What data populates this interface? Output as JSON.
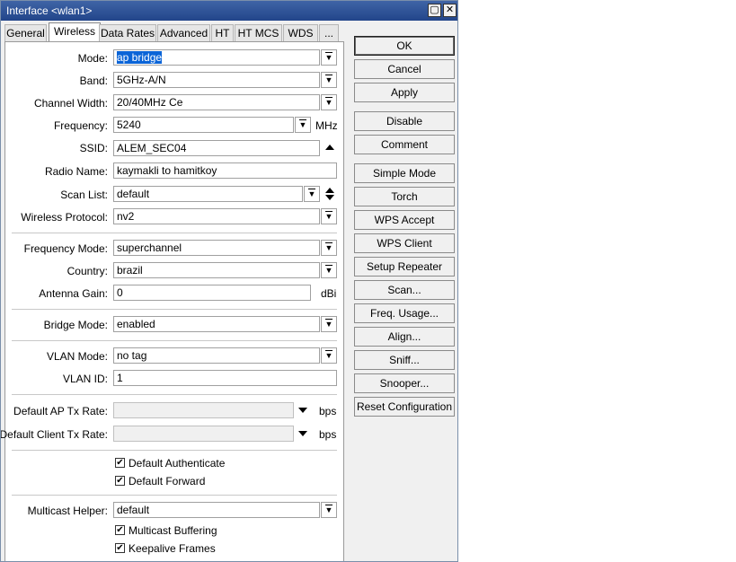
{
  "window": {
    "title": "Interface <wlan1>",
    "maximize_icon": "maximize-icon",
    "close_icon": "close-icon"
  },
  "tabs": [
    "General",
    "Wireless",
    "Data Rates",
    "Advanced",
    "HT",
    "HT MCS",
    "WDS",
    "..."
  ],
  "active_tab": "Wireless",
  "fields": {
    "mode": {
      "label": "Mode:",
      "value": "ap bridge"
    },
    "band": {
      "label": "Band:",
      "value": "5GHz-A/N"
    },
    "channel_width": {
      "label": "Channel Width:",
      "value": "20/40MHz Ce"
    },
    "frequency": {
      "label": "Frequency:",
      "value": "5240",
      "unit": "MHz"
    },
    "ssid": {
      "label": "SSID:",
      "value": "ALEM_SEC04"
    },
    "radio_name": {
      "label": "Radio Name:",
      "value": "kaymakli to hamitkoy"
    },
    "scan_list": {
      "label": "Scan List:",
      "value": "default"
    },
    "wireless_protocol": {
      "label": "Wireless Protocol:",
      "value": "nv2"
    },
    "frequency_mode": {
      "label": "Frequency Mode:",
      "value": "superchannel"
    },
    "country": {
      "label": "Country:",
      "value": "brazil"
    },
    "antenna_gain": {
      "label": "Antenna Gain:",
      "value": "0",
      "unit": "dBi"
    },
    "bridge_mode": {
      "label": "Bridge Mode:",
      "value": "enabled"
    },
    "vlan_mode": {
      "label": "VLAN Mode:",
      "value": "no tag"
    },
    "vlan_id": {
      "label": "VLAN ID:",
      "value": "1"
    },
    "default_ap_tx_rate": {
      "label": "Default AP Tx Rate:",
      "value": "",
      "unit": "bps"
    },
    "default_client_tx_rate": {
      "label": "Default Client Tx Rate:",
      "value": "",
      "unit": "bps"
    },
    "multicast_helper": {
      "label": "Multicast Helper:",
      "value": "default"
    }
  },
  "checkboxes": {
    "default_authenticate": {
      "label": "Default Authenticate",
      "checked": true
    },
    "default_forward": {
      "label": "Default Forward",
      "checked": true
    },
    "multicast_buffering": {
      "label": "Multicast Buffering",
      "checked": true
    },
    "keepalive_frames": {
      "label": "Keepalive Frames",
      "checked": true
    }
  },
  "check_mark": "✔",
  "buttons": [
    "OK",
    "Cancel",
    "Apply",
    "Disable",
    "Comment",
    "Simple Mode",
    "Torch",
    "WPS Accept",
    "WPS Client",
    "Setup Repeater",
    "Scan...",
    "Freq. Usage...",
    "Align...",
    "Sniff...",
    "Snooper...",
    "Reset Configuration"
  ]
}
